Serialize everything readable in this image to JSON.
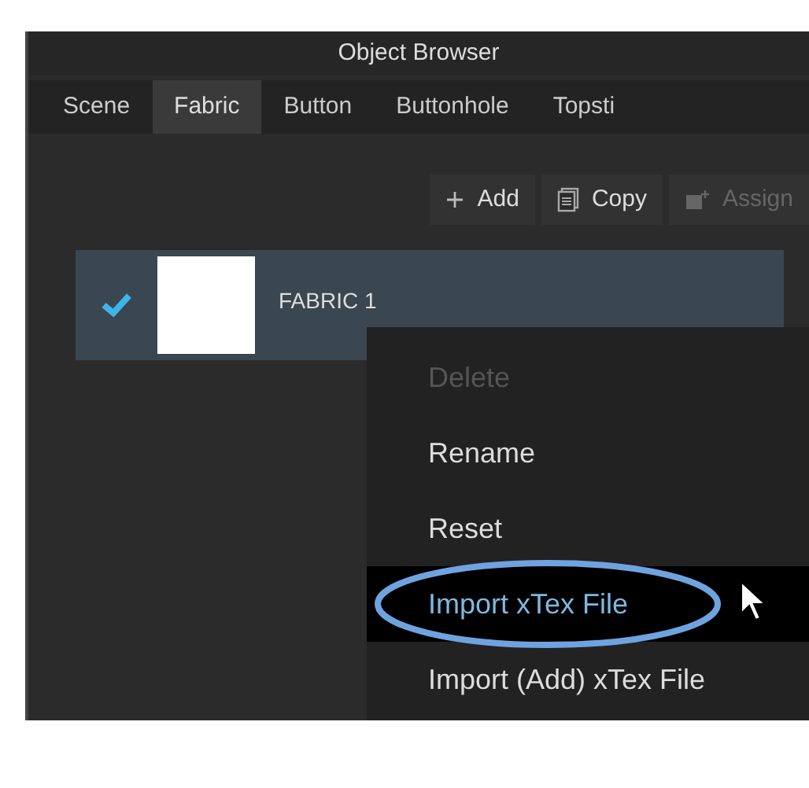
{
  "window": {
    "title": "Object Browser"
  },
  "tabs": [
    {
      "label": "Scene",
      "selected": false
    },
    {
      "label": "Fabric",
      "selected": true
    },
    {
      "label": "Button",
      "selected": false
    },
    {
      "label": "Buttonhole",
      "selected": false
    },
    {
      "label": "Topsti",
      "selected": false
    }
  ],
  "toolbar": [
    {
      "label": "Add",
      "kind": "add",
      "disabled": false
    },
    {
      "label": "Copy",
      "kind": "copy",
      "disabled": false
    },
    {
      "label": "Assign",
      "kind": "assign",
      "disabled": true
    }
  ],
  "list": [
    {
      "name": "FABRIC 1",
      "checked": true,
      "selected": true
    }
  ],
  "context_menu": [
    {
      "label": "Delete",
      "disabled": true,
      "selected": false
    },
    {
      "label": "Rename",
      "disabled": false,
      "selected": false
    },
    {
      "label": "Reset",
      "disabled": false,
      "selected": false
    },
    {
      "label": "Import xTex File",
      "disabled": false,
      "selected": true
    },
    {
      "label": "Import (Add) xTex File",
      "disabled": false,
      "selected": false
    }
  ]
}
